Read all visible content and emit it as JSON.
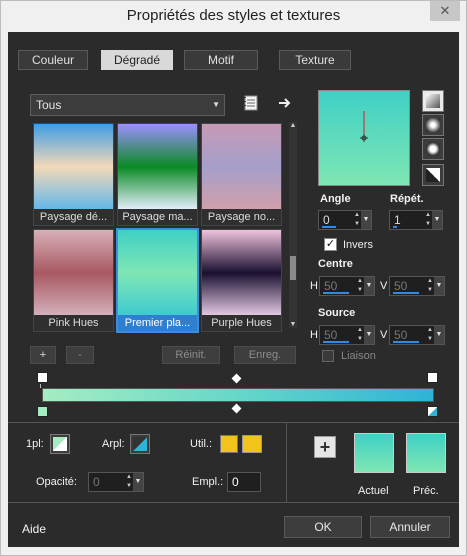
{
  "window": {
    "title": "Propriétés des styles et textures",
    "close": "✕"
  },
  "tabs": [
    "Couleur",
    "Dégradé",
    "Motif",
    "Texture"
  ],
  "category": {
    "value": "Tous"
  },
  "gradients": [
    {
      "label": "Paysage dé...",
      "colors": [
        "#3f9de6",
        "#f3d9b8",
        "#61b6ea"
      ]
    },
    {
      "label": "Paysage ma...",
      "colors": [
        "#9c8fff",
        "#0a8a24",
        "#e8f0ff"
      ]
    },
    {
      "label": "Paysage no...",
      "colors": [
        "#c79ab6",
        "#a59fca",
        "#d29faa"
      ]
    },
    {
      "label": "Pink Hues",
      "colors": [
        "#d7b0b8",
        "#a85862",
        "#d3b2bc"
      ]
    },
    {
      "label": "Premier pla...",
      "colors": [
        "#3fd0c5",
        "#7fe6b4",
        "#3ecad0"
      ]
    },
    {
      "label": "Purple Hues",
      "colors": [
        "#f0c3de",
        "#1a0f30",
        "#e6cde6"
      ]
    }
  ],
  "gallery_buttons": {
    "add": "+",
    "remove": "-",
    "reset": "Réinit.",
    "save": "Enreg."
  },
  "angle": {
    "label": "Angle",
    "value": "0"
  },
  "repeat": {
    "label": "Répét.",
    "value": "1"
  },
  "invert": {
    "label": "Invers",
    "checked": true
  },
  "centre": {
    "label": "Centre",
    "h_label": "H",
    "h": "50",
    "v_label": "V",
    "v": "50"
  },
  "source": {
    "label": "Source",
    "h_label": "H",
    "h": "50",
    "v_label": "V",
    "v": "50",
    "link_label": "Liaison"
  },
  "editor": {
    "fpl_label": "1pl:",
    "arpl_label": "Arpl:",
    "util_label": "Util.:",
    "opacity_label": "Opacité:",
    "opacity_value": "0",
    "empl_label": "Empl.:",
    "empl_value": "0",
    "util_color": "#f2c31b"
  },
  "preview": {
    "current_label": "Actuel",
    "previous_label": "Préc.",
    "add": "+"
  },
  "footer": {
    "help": "Aide",
    "ok": "OK",
    "cancel": "Annuler"
  }
}
